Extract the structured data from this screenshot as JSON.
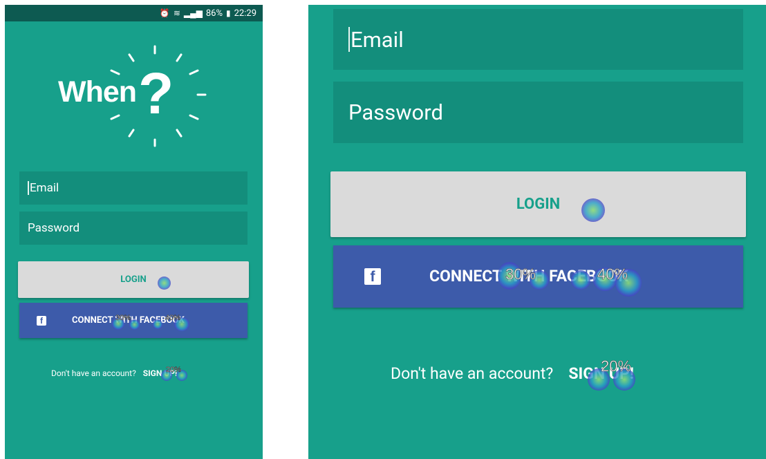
{
  "left_screen": {
    "statusbar": {
      "alarm_icon": "alarm-icon",
      "wifi_icon": "wifi-icon",
      "signal_icon": "signal-icon",
      "battery_text": "86%",
      "battery_icon": "battery-icon",
      "time": "22:29"
    },
    "logo": {
      "word": "When",
      "mark": "?"
    },
    "email_placeholder": "Email",
    "password_placeholder": "Password",
    "login_label": "LOGIN",
    "facebook_label": "CONNECT WITH FACEBOOK",
    "facebook_icon_glyph": "f",
    "signup_prompt": "Don't have an account?",
    "signup_cta": "SIGN UP!",
    "heatmap": {
      "facebook_left_pct": "30%",
      "facebook_right_pct": "40%",
      "signup_pct": "20%"
    }
  },
  "right_screen": {
    "email_placeholder": "Email",
    "password_placeholder": "Password",
    "login_label": "LOGIN",
    "facebook_label": "CONNECT WITH FACEBOOK",
    "facebook_icon_glyph": "f",
    "signup_prompt": "Don't have an account?",
    "signup_cta": "SIGN UP!",
    "heatmap": {
      "facebook_left_pct": "30%",
      "facebook_right_pct": "40%",
      "signup_pct": "20%"
    }
  },
  "colors": {
    "background_teal": "#17a08b",
    "field_teal": "#138e7c",
    "statusbar": "#0d5a51",
    "login_button": "#dadada",
    "facebook_blue": "#3d5baa"
  }
}
